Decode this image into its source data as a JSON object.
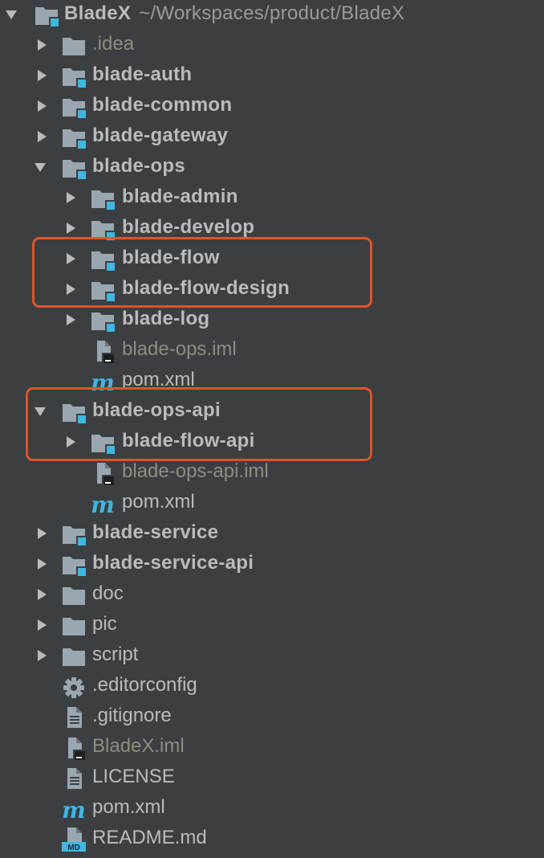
{
  "root": {
    "name": "BladeX",
    "path": "~/Workspaces/product/BladeX"
  },
  "items": [
    {
      "label": ".idea"
    },
    {
      "label": "blade-auth"
    },
    {
      "label": "blade-common"
    },
    {
      "label": "blade-gateway"
    },
    {
      "label": "blade-ops"
    },
    {
      "label": "blade-admin"
    },
    {
      "label": "blade-develop"
    },
    {
      "label": "blade-flow"
    },
    {
      "label": "blade-flow-design"
    },
    {
      "label": "blade-log"
    },
    {
      "label": "blade-ops.iml"
    },
    {
      "label": "pom.xml"
    },
    {
      "label": "blade-ops-api"
    },
    {
      "label": "blade-flow-api"
    },
    {
      "label": "blade-ops-api.iml"
    },
    {
      "label": "pom.xml"
    },
    {
      "label": "blade-service"
    },
    {
      "label": "blade-service-api"
    },
    {
      "label": "doc"
    },
    {
      "label": "pic"
    },
    {
      "label": "script"
    },
    {
      "label": ".editorconfig"
    },
    {
      "label": ".gitignore"
    },
    {
      "label": "BladeX.iml"
    },
    {
      "label": "LICENSE"
    },
    {
      "label": "pom.xml"
    },
    {
      "label": "README.md"
    }
  ],
  "colors": {
    "background": "#3c3f41",
    "text": "#bbbbbb",
    "excluded_text": "#8a8f80",
    "folder": "#9aa7b0",
    "module_badge": "#40b6e0",
    "maven_m": "#40b6e0",
    "highlight_border": "#e0532a"
  },
  "icons": {
    "expanded": "triangle-down",
    "collapsed": "triangle-right",
    "folder": "folder-icon",
    "module": "module-folder-icon",
    "iml": "iml-file-icon",
    "maven": "maven-m-icon",
    "settings": "gear-icon",
    "text_file": "text-file-icon",
    "markdown": "markdown-file-icon"
  }
}
